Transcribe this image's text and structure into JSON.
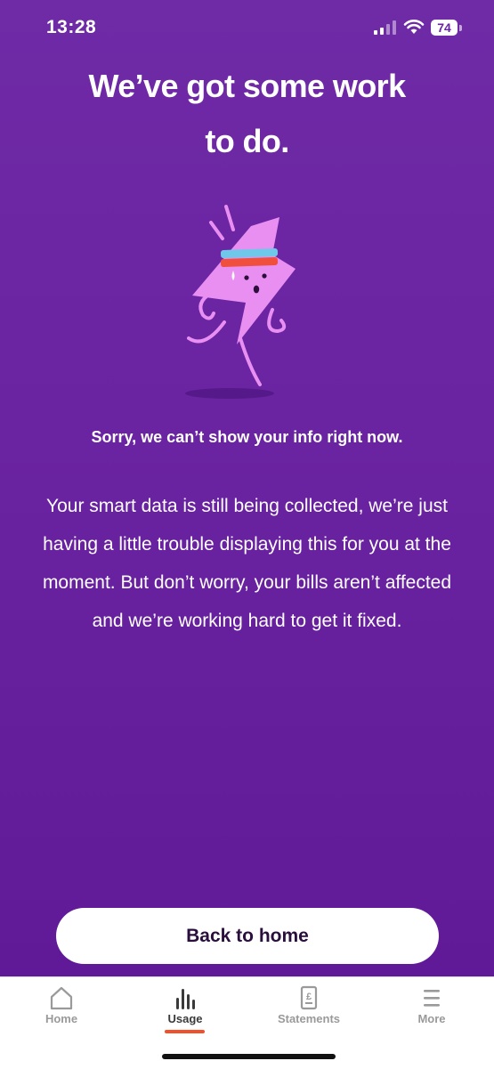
{
  "status_bar": {
    "time": "13:28",
    "battery": "74"
  },
  "headline": "We’ve got some work to do.",
  "subheading": "Sorry, we can’t show your info right now.",
  "body": "Your smart data is still being collected, we’re just having a little trouble displaying this for you at the moment. But don’t worry, your bills aren’t affected and we’re working hard to get it fixed.",
  "back_button": "Back to home",
  "tabs": [
    {
      "label": "Home",
      "icon": "home-icon"
    },
    {
      "label": "Usage",
      "icon": "usage-bars-icon",
      "active": true
    },
    {
      "label": "Statements",
      "icon": "statement-icon"
    },
    {
      "label": "More",
      "icon": "menu-icon"
    }
  ],
  "colors": {
    "background": "#6a23a1",
    "accent": "#f0502a",
    "mascot": "#e98ff2"
  }
}
